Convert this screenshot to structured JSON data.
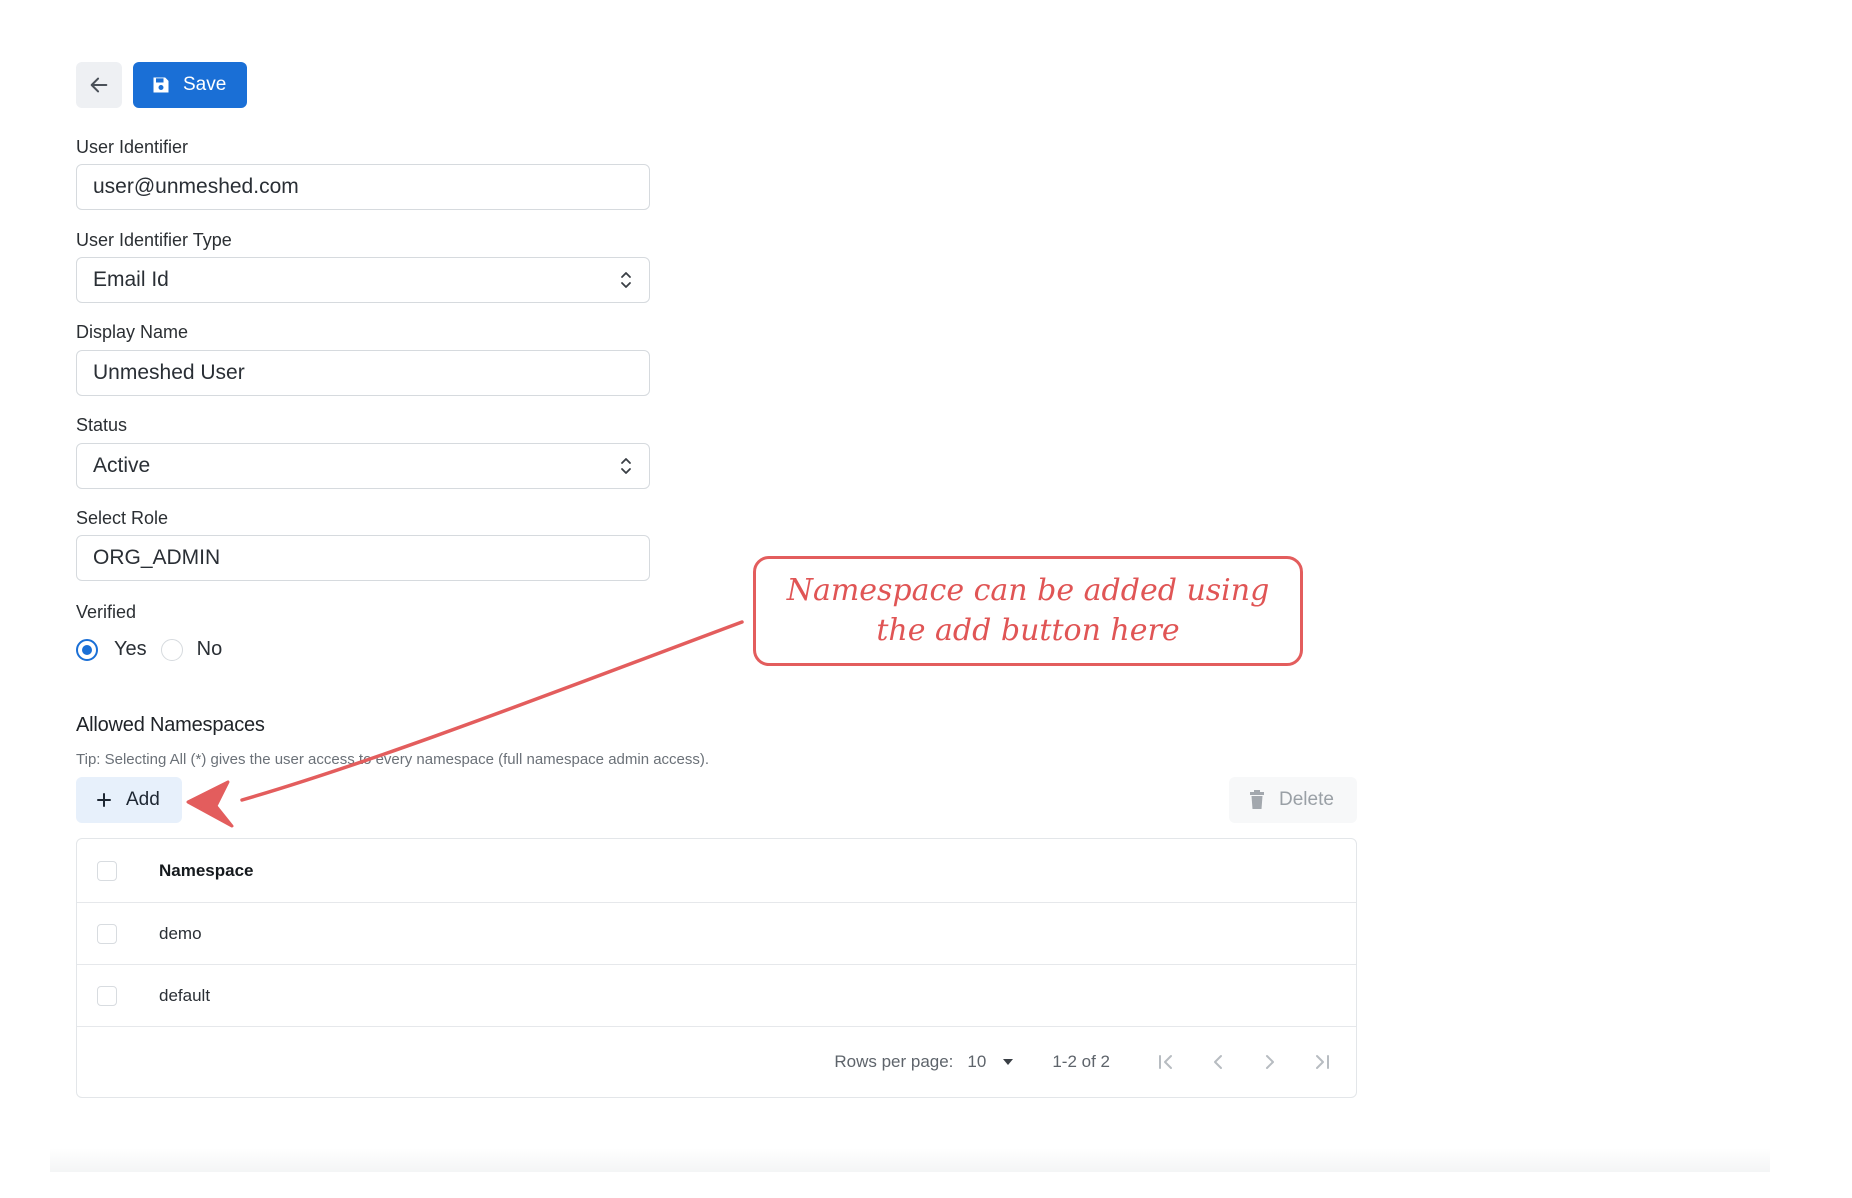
{
  "toolbar": {
    "save_label": "Save"
  },
  "form": {
    "user_identifier": {
      "label": "User Identifier",
      "value": "user@unmeshed.com"
    },
    "user_identifier_type": {
      "label": "User Identifier Type",
      "value": "Email Id"
    },
    "display_name": {
      "label": "Display Name",
      "value": "Unmeshed User"
    },
    "status": {
      "label": "Status",
      "value": "Active"
    },
    "select_role": {
      "label": "Select Role",
      "value": "ORG_ADMIN"
    },
    "verified": {
      "label": "Verified",
      "options": [
        "Yes",
        "No"
      ],
      "selected": "Yes"
    }
  },
  "namespaces": {
    "title": "Allowed Namespaces",
    "tip": "Tip: Selecting All (*) gives the user access to every namespace (full namespace admin access).",
    "add_label": "Add",
    "delete_label": "Delete",
    "column_header": "Namespace",
    "rows": [
      "demo",
      "default"
    ],
    "pagination": {
      "rows_per_page_label": "Rows per page:",
      "rows_per_page_value": "10",
      "range": "1-2 of 2"
    }
  },
  "annotation": {
    "line1": "Namespace can be added using",
    "line2": "the add button here",
    "color": "#e35d5d"
  },
  "colors": {
    "primary": "#1a6fd6",
    "add_button_bg": "#e7f0fb"
  },
  "icons": [
    "arrow-left-icon",
    "floppy-disk-icon",
    "plus-icon",
    "trash-icon",
    "updown-chevron-icon",
    "caret-down-icon",
    "first-page-icon",
    "prev-page-icon",
    "next-page-icon",
    "last-page-icon"
  ]
}
